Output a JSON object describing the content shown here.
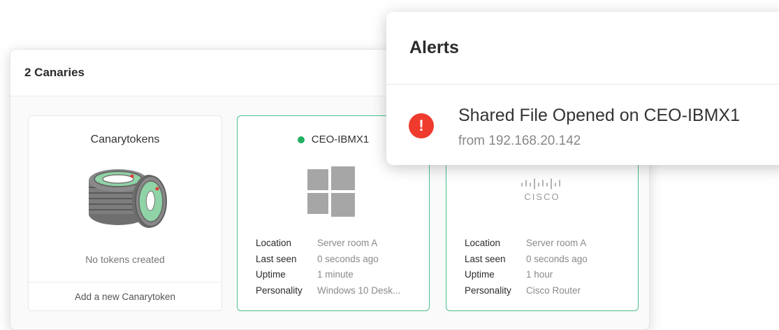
{
  "dashboard": {
    "title": "2 Canaries"
  },
  "tokens": {
    "title": "Canarytokens",
    "empty_text": "No tokens created",
    "add_label": "Add a new Canarytoken"
  },
  "devices": [
    {
      "name": "CEO-IBMX1",
      "status_color": "#22b063",
      "icon": "windows-logo-icon",
      "props": [
        {
          "key": "Location",
          "value": "Server room A"
        },
        {
          "key": "Last seen",
          "value": "0 seconds ago"
        },
        {
          "key": "Uptime",
          "value": "1 minute"
        },
        {
          "key": "Personality",
          "value": "Windows 10 Desk..."
        }
      ]
    },
    {
      "icon": "cisco-logo-icon",
      "logo_text": "CISCO",
      "props": [
        {
          "key": "Location",
          "value": "Server room A"
        },
        {
          "key": "Last seen",
          "value": "0 seconds ago"
        },
        {
          "key": "Uptime",
          "value": "1 hour"
        },
        {
          "key": "Personality",
          "value": "Cisco Router"
        }
      ]
    }
  ],
  "alerts": {
    "title": "Alerts",
    "items": [
      {
        "icon": "exclamation-icon",
        "badge": "!",
        "title": "Shared File Opened on CEO-IBMX1",
        "subtitle": "from 192.168.20.142"
      }
    ]
  },
  "colors": {
    "accent_green": "#4cbf8b",
    "status_online": "#22b063",
    "alert_red": "#ef3b2d"
  }
}
